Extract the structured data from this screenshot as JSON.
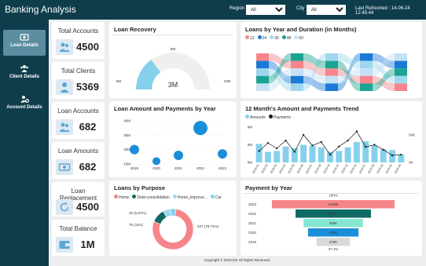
{
  "header": {
    "title": "Banking Analysis",
    "region_label": "Region",
    "region_value": "All",
    "city_label": "City",
    "city_value": "All",
    "refreshed": "Last Refreshed : 14-06-24 12:45:44"
  },
  "sidebar": [
    {
      "label": "Loan Details",
      "icon": "money-icon",
      "active": true
    },
    {
      "label": "Client Details",
      "icon": "users-icon",
      "active": false
    },
    {
      "label": "Account  Details",
      "icon": "user-settings-icon",
      "active": false
    }
  ],
  "kpis": [
    {
      "label": "Total Accounts",
      "value": "4500",
      "icon": "users-icon"
    },
    {
      "label": "Total Clients",
      "value": "5369",
      "icon": "user-icon"
    },
    {
      "label": "Loan Accounts",
      "value": "682",
      "icon": "users-icon"
    },
    {
      "label": "Loan Amounts",
      "value": "682",
      "icon": "cash-icon"
    },
    {
      "label": "Loan Replacement",
      "value": "4500",
      "icon": "refresh-icon"
    },
    {
      "label": "Total Balance",
      "value": "1M",
      "icon": "wallet-icon"
    }
  ],
  "loan_recovery": {
    "title": "Loan Recovery",
    "min_label": "0M",
    "max_label": "10M",
    "top_label": "5M",
    "value_label": "3M",
    "fraction": 0.3,
    "colors": {
      "value": "#85d0ec",
      "track": "#f0efed"
    }
  },
  "duration": {
    "title": "Loans by Year and Duration (in Months)",
    "legend": [
      {
        "label": "12",
        "color": "#f5858a"
      },
      {
        "label": "24",
        "color": "#1a7ad6"
      },
      {
        "label": "36",
        "color": "#9ed7ee"
      },
      {
        "label": "48",
        "color": "#1aa391"
      },
      {
        "label": "60",
        "color": "#c4e1f5"
      }
    ]
  },
  "amount_year": {
    "title": "Loan Amount and Payments by Year",
    "color": "#1a8fd8",
    "chart_data": {
      "type": "scatter",
      "x": [
        "2019",
        "2020",
        "2021",
        "2022",
        "2023"
      ],
      "y_ticks": [
        "40M",
        "30M",
        "20M",
        "10M"
      ],
      "ylim": [
        10,
        40
      ],
      "values": [
        20,
        12,
        16,
        35,
        17
      ],
      "bubble_size": [
        6,
        5,
        6,
        9,
        6
      ]
    }
  },
  "trend": {
    "title": "12 Month's Amount and Payments Trend",
    "legend": [
      {
        "label": "Amounts",
        "color": "#85d0ec"
      },
      {
        "label": "Payments",
        "color": "#111111"
      }
    ],
    "chart_data": {
      "type": "bar",
      "categories": [
        "2023-01",
        "2023-02",
        "2023-03",
        "2023-04",
        "2023-05",
        "2023-06",
        "2023-07",
        "2023-08",
        "2023-09",
        "2023-10",
        "2023-11",
        "2023-12",
        "2024-01",
        "2024-02",
        "2024-03",
        "2024-04",
        "2024-05"
      ],
      "y_ticks": [
        "4M",
        "2M",
        "0M"
      ],
      "ylim": [
        0,
        4
      ],
      "y2_ticks": [
        "50K",
        "0K"
      ],
      "y2lim": [
        0,
        100
      ],
      "series": [
        {
          "name": "Amounts",
          "values": [
            2.1,
            1.2,
            1.3,
            1.8,
            1.6,
            2.0,
            1.9,
            1.7,
            1.2,
            1.3,
            1.7,
            2.3,
            2.4,
            1.9,
            1.5,
            1.4,
            0.9
          ]
        },
        {
          "name": "Payments",
          "values": [
            32,
            55,
            40,
            62,
            30,
            78,
            48,
            58,
            22,
            45,
            62,
            88,
            44,
            50,
            36,
            20,
            22
          ]
        }
      ]
    }
  },
  "purpose": {
    "title": "Loans by Purpose",
    "legend": [
      {
        "label": "Home",
        "color": "#f5858a"
      },
      {
        "label": "Debt-consolidation",
        "color": "#0f6a64"
      },
      {
        "label": "Home_improve...",
        "color": "#9ed7ee"
      },
      {
        "label": "Car",
        "color": "#85d0ec"
      }
    ],
    "chart_data": {
      "type": "pie",
      "labels": [
        "Home",
        "Debt-consolidation",
        "Home_improve...",
        "Car"
      ],
      "values": [
        537,
        75,
        40,
        30
      ],
      "data_labels": [
        "537 (78.74%)",
        "75 (11%)",
        "40 (5.87%)",
        ""
      ]
    }
  },
  "payment_year": {
    "title": "Payment by Year",
    "top_label": "100%",
    "bottom_label": "27.4%",
    "chart_data": {
      "type": "bar",
      "categories": [
        "2023",
        "2022",
        "2021",
        "2020",
        "2019"
      ],
      "values": [
        1020,
        627,
        493,
        420,
        279
      ],
      "data_labels": [
        "1020K",
        "627K",
        "493K",
        "420K",
        "279K"
      ],
      "colors": [
        "#f5858a",
        "#0f6a64",
        "#85e6d2",
        "#1a8fd8",
        "#d9d9d9"
      ]
    }
  },
  "footer": "Copyright © 2023-DK All Rights Reserved."
}
